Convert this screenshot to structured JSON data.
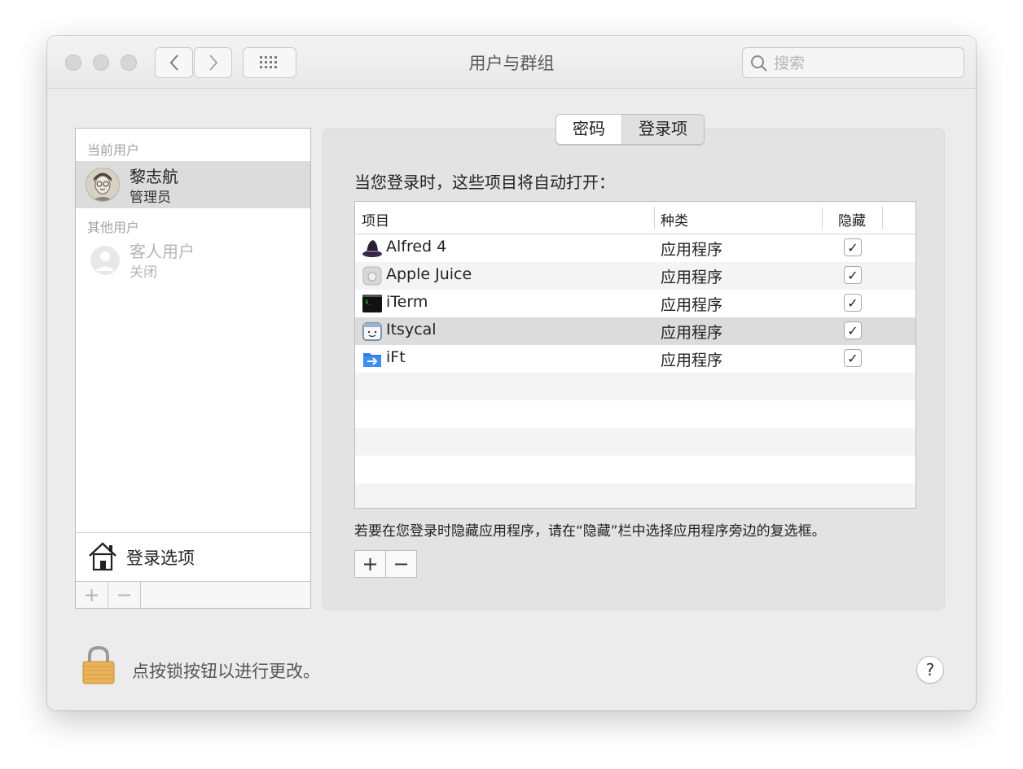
{
  "window": {
    "title": "用户与群组",
    "search_placeholder": "搜索"
  },
  "sidebar": {
    "current_users_header": "当前用户",
    "current_user": {
      "name": "黎志航",
      "role": "管理员"
    },
    "other_users_header": "其他用户",
    "guest_user": {
      "name": "客人用户",
      "status": "关闭"
    },
    "login_options_label": "登录选项",
    "add_label": "+",
    "remove_label": "−"
  },
  "tabs": [
    {
      "label": "密码",
      "active": false
    },
    {
      "label": "登录项",
      "active": true
    }
  ],
  "login_items": {
    "intro": "当您登录时，这些项目将自动打开：",
    "columns": {
      "item": "项目",
      "kind": "种类",
      "hide": "隐藏"
    },
    "rows": [
      {
        "name": "Alfred 4",
        "kind": "应用程序",
        "hidden": true,
        "check": "✓",
        "icon": "alfred-icon"
      },
      {
        "name": "Apple Juice",
        "kind": "应用程序",
        "hidden": true,
        "check": "✓",
        "icon": "apple-juice-icon"
      },
      {
        "name": "iTerm",
        "kind": "应用程序",
        "hidden": true,
        "check": "✓",
        "icon": "iterm-icon"
      },
      {
        "name": "Itsycal",
        "kind": "应用程序",
        "hidden": true,
        "check": "✓",
        "icon": "itsycal-icon",
        "selected": true
      },
      {
        "name": "iFt",
        "kind": "应用程序",
        "hidden": true,
        "check": "✓",
        "icon": "ift-icon"
      }
    ],
    "note": "若要在您登录时隐藏应用程序，请在“隐藏”栏中选择应用程序旁边的复选框。",
    "add_label": "+",
    "remove_label": "−"
  },
  "footer": {
    "lock_text": "点按锁按钮以进行更改。",
    "help_label": "?"
  },
  "colors": {
    "window_bg": "#ececec",
    "selection": "#dcdcdc",
    "lock_gold": "#e9b45a"
  }
}
